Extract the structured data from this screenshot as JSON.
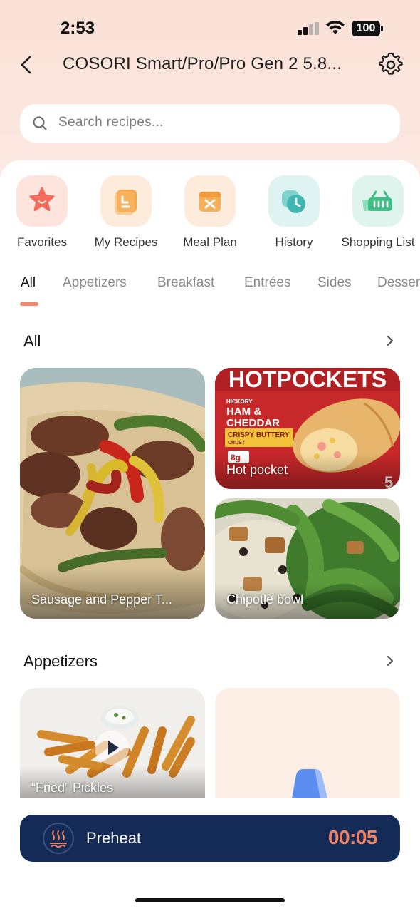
{
  "status_bar": {
    "time": "2:53",
    "battery": "100"
  },
  "header": {
    "title": "COSORI Smart/Pro/Pro Gen 2 5.8...",
    "back_icon": "chevron-left-icon",
    "settings_icon": "gear-icon"
  },
  "search": {
    "placeholder": "Search recipes..."
  },
  "quick_actions": [
    {
      "label": "Favorites",
      "icon": "star-icon",
      "bg": "#fde4dc",
      "fg": "#f26b5b"
    },
    {
      "label": "My Recipes",
      "icon": "recipe-card-icon",
      "bg": "#fdecdc",
      "fg": "#f5a84f"
    },
    {
      "label": "Meal Plan",
      "icon": "meal-plan-icon",
      "bg": "#fdebdc",
      "fg": "#f6b05a"
    },
    {
      "label": "History",
      "icon": "clock-icon",
      "bg": "#dff3f2",
      "fg": "#3fb7b0"
    },
    {
      "label": "Shopping List",
      "icon": "basket-icon",
      "bg": "#dff4ec",
      "fg": "#3dbf86"
    }
  ],
  "tabs": [
    "All",
    "Appetizers",
    "Breakfast",
    "Entrées",
    "Sides",
    "Desser"
  ],
  "active_tab": "All",
  "sections": {
    "all": {
      "title": "All",
      "recipes": [
        "Sausage and Pepper T...",
        "Hot pocket",
        "Chipotle bowl"
      ]
    },
    "appetizers": {
      "title": "Appetizers",
      "recipes": [
        "“Fried” Pickles",
        ""
      ]
    }
  },
  "hotpocket_box": {
    "brand": "HOTPOCKETS",
    "flavor_small": "HICKORY",
    "flavor_1": "HAM &",
    "flavor_2": "CHEDDAR",
    "crust": "CRISPY BUTTERY",
    "crust_2": "CRUST",
    "protein": "8g",
    "count": "5"
  },
  "preheat": {
    "label": "Preheat",
    "time": "00:05"
  },
  "colors": {
    "accent": "#f28869",
    "preheat_bg": "#142b57",
    "preheat_time": "#f0805f"
  }
}
